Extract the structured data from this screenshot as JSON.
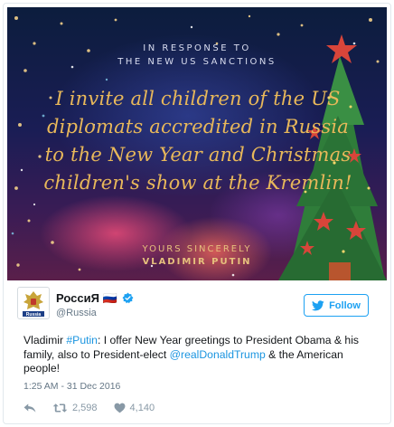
{
  "image": {
    "line1": "In response to",
    "line2": "the new US sanctions",
    "message_lines": [
      "I invite all children of the US",
      "diplomats accredited in Russia",
      "to the New Year and Christmas",
      "children's show at the Kremlin!"
    ],
    "sign_line1": "Yours sincerely",
    "sign_line2": "Vladimir Putin"
  },
  "author": {
    "display_name": "РоссиЯ 🇷🇺",
    "handle": "@Russia",
    "verified_icon": "verified-badge-icon",
    "avatar_label": "Russia"
  },
  "follow_button": {
    "label": "Follow",
    "icon": "twitter-bird-icon"
  },
  "tweet": {
    "part1": "Vladimir ",
    "hashtag": "#Putin",
    "part2": ": I offer New Year greetings to President Obama & his family, also to President-elect ",
    "mention": "@realDonaldTrump",
    "part3": " & the American people!"
  },
  "timestamp": "1:25 AM - 31 Dec 2016",
  "actions": {
    "reply_icon": "reply-icon",
    "retweet_icon": "retweet-icon",
    "retweet_count": "2,598",
    "like_icon": "heart-icon",
    "like_count": "4,140"
  },
  "colors": {
    "link": "#1b95e0",
    "follow": "#1da1f2",
    "verified": "#1da1f2",
    "tree": "#2e7d32",
    "star": "#d8453a",
    "script_text": "#e8b85a"
  }
}
